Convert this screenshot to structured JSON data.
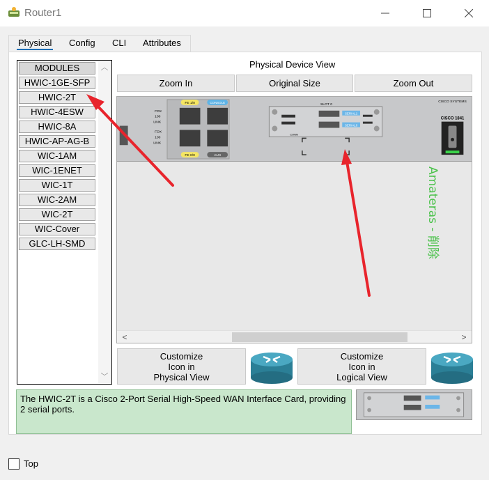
{
  "window": {
    "title": "Router1"
  },
  "tabs": [
    "Physical",
    "Config",
    "CLI",
    "Attributes"
  ],
  "modules": {
    "header": "MODULES",
    "items": [
      "HWIC-1GE-SFP",
      "HWIC-2T",
      "HWIC-4ESW",
      "HWIC-8A",
      "HWIC-AP-AG-B",
      "WIC-1AM",
      "WIC-1ENET",
      "WIC-1T",
      "WIC-2AM",
      "WIC-2T",
      "WIC-Cover",
      "GLC-LH-SMD"
    ]
  },
  "device_view": {
    "label": "Physical Device View",
    "zoom_in": "Zoom In",
    "original_size": "Original Size",
    "zoom_out": "Zoom Out",
    "chassis": {
      "fe_1_0": "FE 1/0",
      "console": "CONSOLE",
      "fe_0_0": "FE 0/0",
      "aux": "AUX",
      "fdx": "FDX",
      "speed": "100",
      "link": "LINK",
      "slot": "SLOT 0",
      "serial1": "SERIAL1",
      "serial0": "SERIAL0",
      "conn": "CONN",
      "brand": "CISCO SYSTEMS",
      "model": "CISCO 1841"
    }
  },
  "watermark": "Amateras - 削除",
  "customize_physical": [
    "Customize",
    "Icon in",
    "Physical View"
  ],
  "customize_logical": [
    "Customize",
    "Icon in",
    "Logical View"
  ],
  "description": "The HWIC-2T is a Cisco 2-Port Serial High-Speed WAN Interface Card, providing 2 serial ports.",
  "bottom": {
    "top_label": "Top"
  },
  "colors": {
    "desc_bg": "#c9e7cc",
    "arrow": "#e8242c",
    "watermark": "#4cc24c",
    "tab_underline": "#1f6fb5"
  }
}
